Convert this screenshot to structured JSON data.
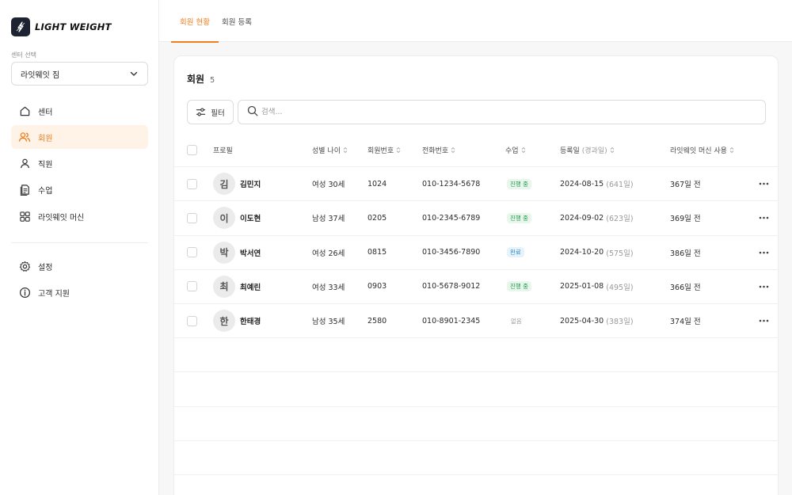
{
  "brand": {
    "name": "LIGHT WEIGHT"
  },
  "center": {
    "label": "센터 선택",
    "selected": "라잇웨잇 짐"
  },
  "nav": [
    {
      "label": "센터",
      "icon": "home-icon"
    },
    {
      "label": "회원",
      "icon": "users-icon",
      "active": true
    },
    {
      "label": "직원",
      "icon": "user-icon"
    },
    {
      "label": "수업",
      "icon": "class-icon"
    },
    {
      "label": "라잇웨잇 머신",
      "icon": "grid-icon"
    }
  ],
  "nav2": [
    {
      "label": "설정",
      "icon": "gear-icon"
    },
    {
      "label": "고객 지원",
      "icon": "info-icon"
    }
  ],
  "tabs": [
    {
      "label": "회원 현황",
      "active": true
    },
    {
      "label": "회원 등록",
      "active": false
    }
  ],
  "card": {
    "title": "회원",
    "count": "5"
  },
  "toolbar": {
    "filter_label": "필터",
    "search_placeholder": "검색..."
  },
  "table": {
    "headers": {
      "profile": "프로필",
      "gender_age": "성별 나이",
      "member_no": "회원번호",
      "phone": "전화번호",
      "class": "수업",
      "reg_date": "등록일",
      "reg_elapsed": "(경과일)",
      "machine": "라잇웨잇 머신 사용"
    },
    "rows": [
      {
        "initial": "김",
        "name": "김민지",
        "gender_age": "여성 30세",
        "member_no": "1024",
        "phone": "010-1234-5678",
        "class_status": "진행 중",
        "class_type": "ongoing",
        "reg_date": "2024-08-15",
        "elapsed": "(641일)",
        "machine": "367일 전"
      },
      {
        "initial": "이",
        "name": "이도현",
        "gender_age": "남성 37세",
        "member_no": "0205",
        "phone": "010-2345-6789",
        "class_status": "진행 중",
        "class_type": "ongoing",
        "reg_date": "2024-09-02",
        "elapsed": "(623일)",
        "machine": "369일 전"
      },
      {
        "initial": "박",
        "name": "박서연",
        "gender_age": "여성 26세",
        "member_no": "0815",
        "phone": "010-3456-7890",
        "class_status": "완료",
        "class_type": "done",
        "reg_date": "2024-10-20",
        "elapsed": "(575일)",
        "machine": "386일 전"
      },
      {
        "initial": "최",
        "name": "최예린",
        "gender_age": "여성 33세",
        "member_no": "0903",
        "phone": "010-5678-9012",
        "class_status": "진행 중",
        "class_type": "ongoing",
        "reg_date": "2025-01-08",
        "elapsed": "(495일)",
        "machine": "366일 전"
      },
      {
        "initial": "한",
        "name": "한태경",
        "gender_age": "남성 35세",
        "member_no": "2580",
        "phone": "010-8901-2345",
        "class_status": "없음",
        "class_type": "none",
        "reg_date": "2025-04-30",
        "elapsed": "(383일)",
        "machine": "374일 전"
      }
    ]
  },
  "colors": {
    "accent": "#f07d1e",
    "ongoing": "#1e9a4b",
    "done": "#2e8ccd"
  }
}
